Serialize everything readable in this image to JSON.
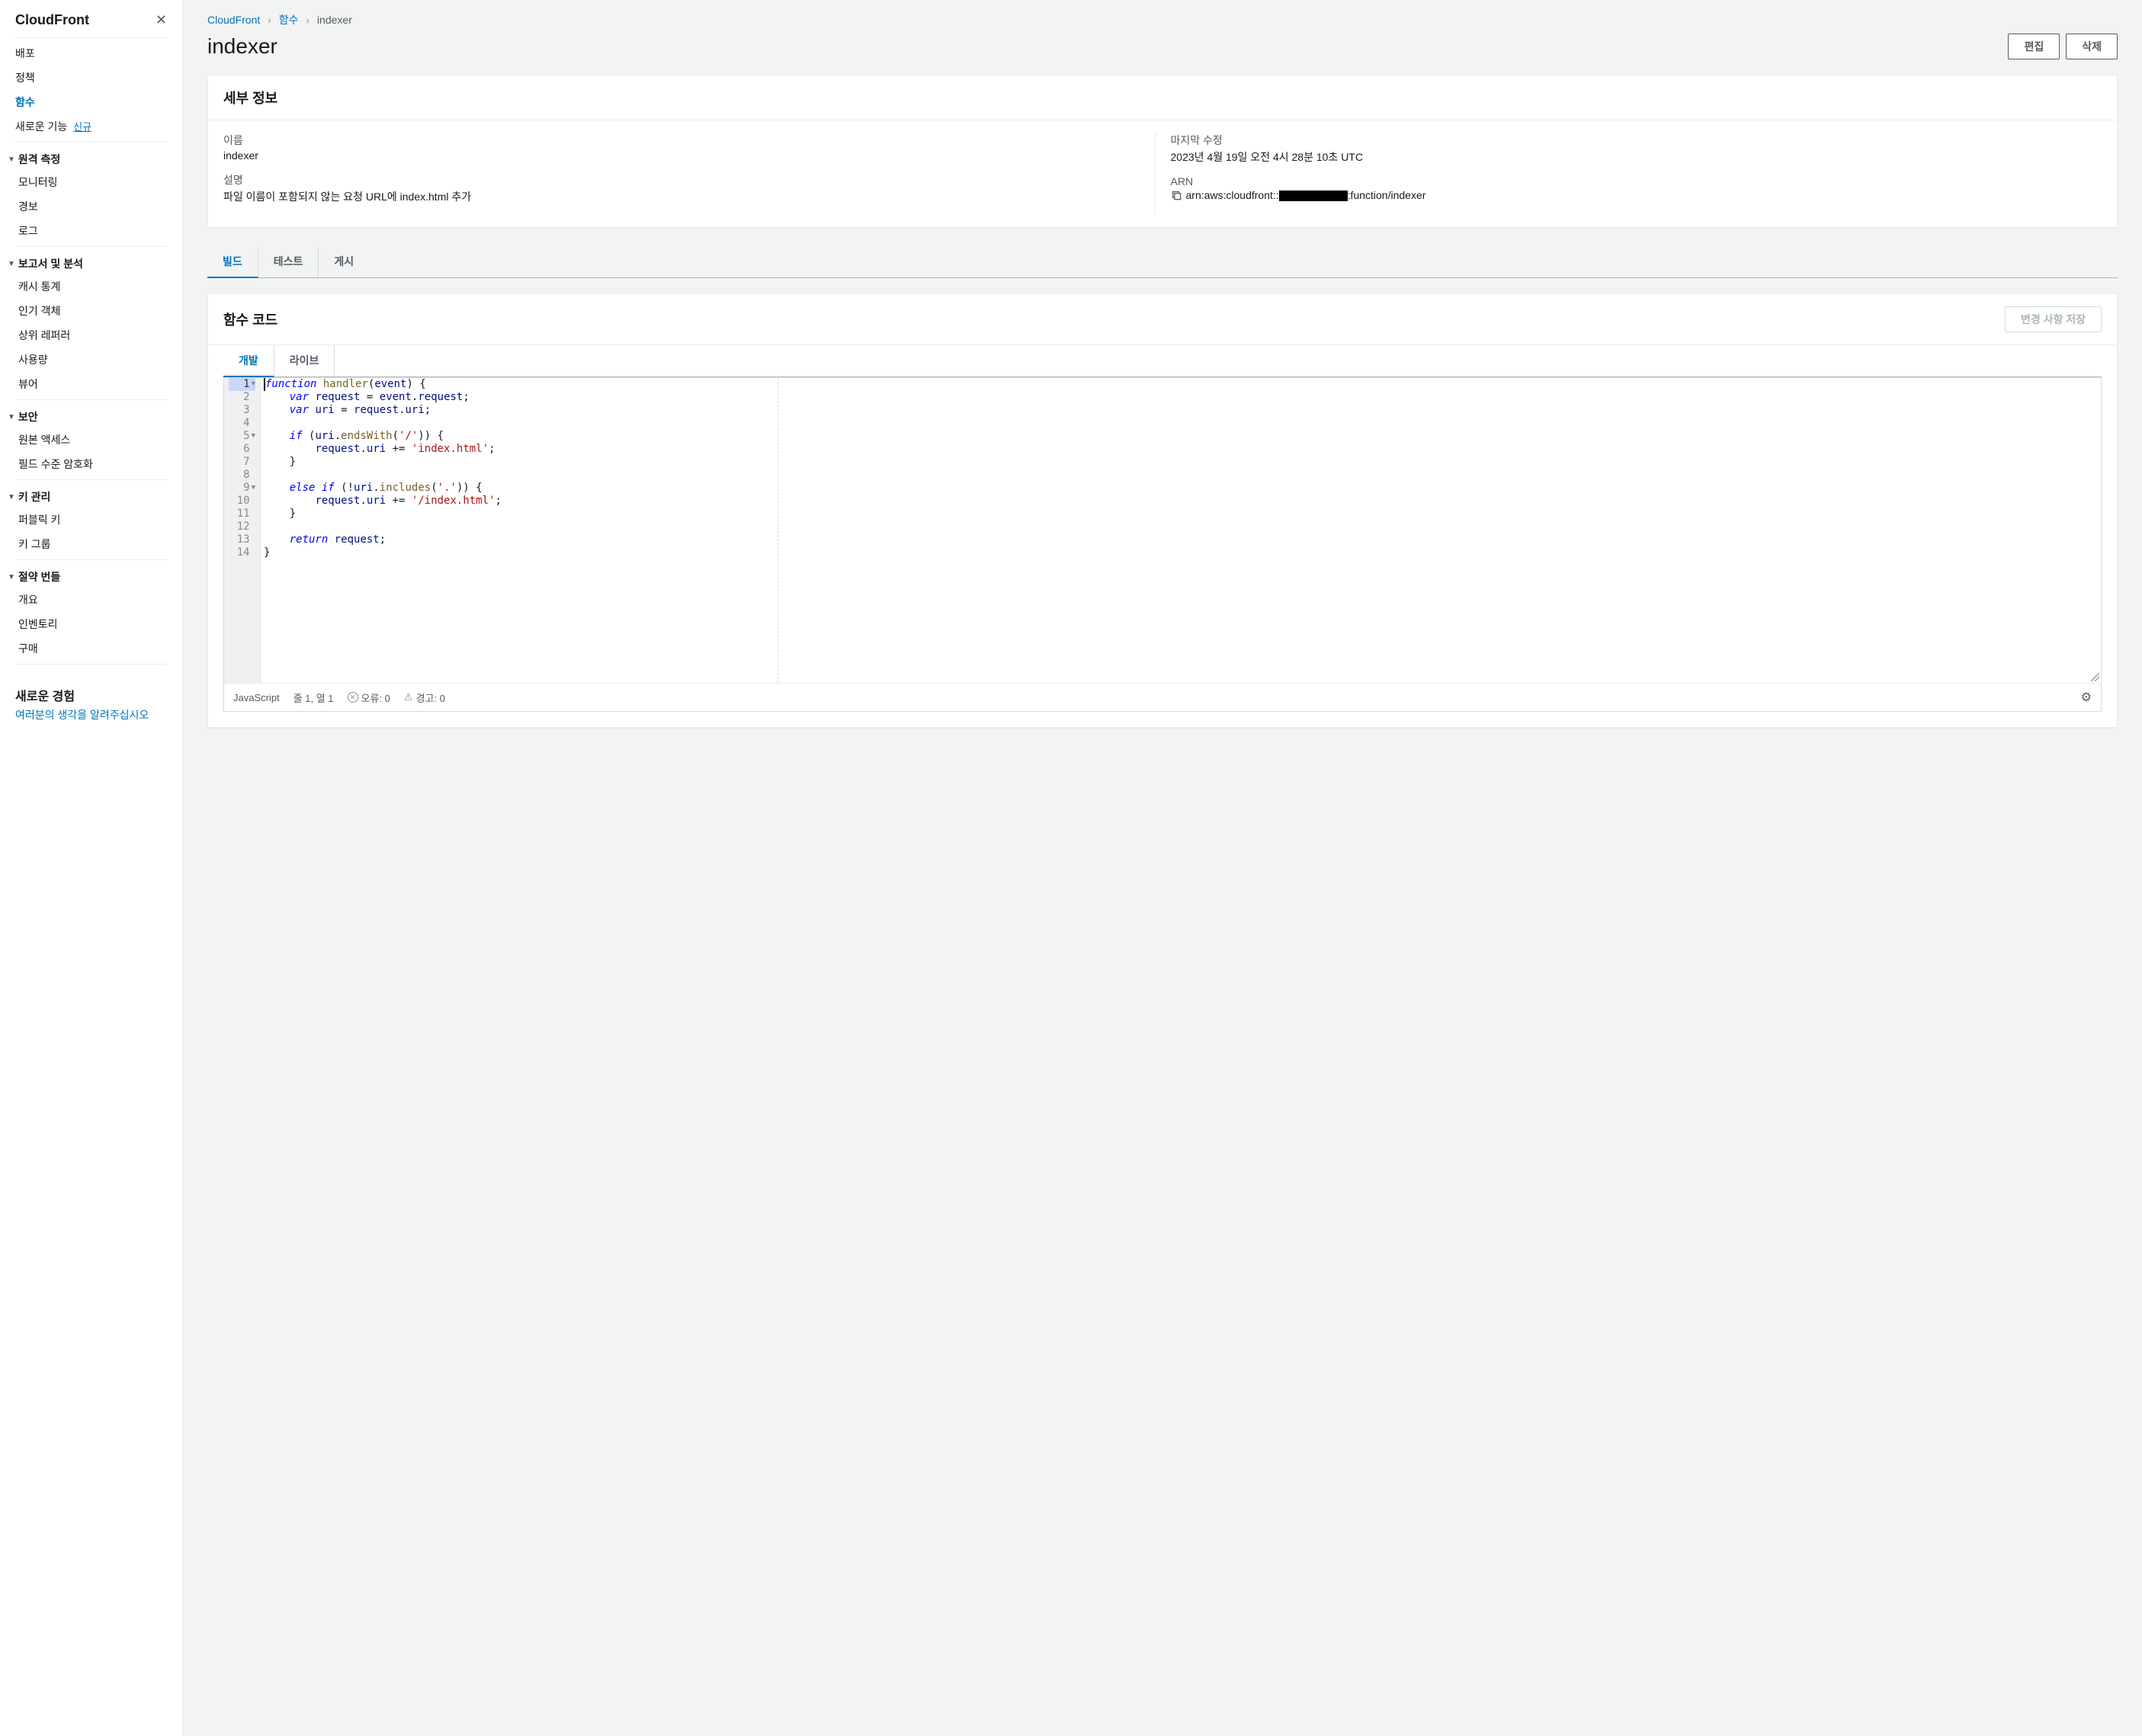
{
  "sidebar": {
    "title": "CloudFront",
    "items_top": [
      {
        "label": "배포",
        "active": false
      },
      {
        "label": "정책",
        "active": false
      },
      {
        "label": "함수",
        "active": true
      },
      {
        "label": "새로운 기능",
        "badge": "신규",
        "active": false
      }
    ],
    "groups": [
      {
        "title": "원격 측정",
        "items": [
          "모니터링",
          "경보",
          "로그"
        ]
      },
      {
        "title": "보고서 및 분석",
        "items": [
          "캐시 통계",
          "인기 객체",
          "상위 레퍼러",
          "사용량",
          "뷰어"
        ]
      },
      {
        "title": "보안",
        "items": [
          "원본 액세스",
          "필드 수준 암호화"
        ]
      },
      {
        "title": "키 관리",
        "items": [
          "퍼블릭 키",
          "키 그룹"
        ]
      },
      {
        "title": "절약 번들",
        "items": [
          "개요",
          "인벤토리",
          "구매"
        ]
      }
    ],
    "footer_title": "새로운 경험",
    "footer_link": "여러분의 생각을 알려주십시오"
  },
  "breadcrumb": {
    "root": "CloudFront",
    "mid": "함수",
    "leaf": "indexer"
  },
  "page": {
    "title": "indexer",
    "edit_btn": "편집",
    "delete_btn": "삭제"
  },
  "details": {
    "header": "세부 정보",
    "name_label": "이름",
    "name_value": "indexer",
    "desc_label": "설명",
    "desc_value": "파일 이름이 포함되지 않는 요청 URL에 index.html 추가",
    "modified_label": "마지막 수정",
    "modified_value": "2023년 4월 19일 오전 4시 28분 10초 UTC",
    "arn_label": "ARN",
    "arn_prefix": "arn:aws:cloudfront::",
    "arn_suffix": ":function/indexer"
  },
  "tabs": {
    "build": "빌드",
    "test": "테스트",
    "publish": "게시"
  },
  "code_card": {
    "header": "함수 코드",
    "save_btn": "변경 사항 저장"
  },
  "sub_tabs": {
    "dev": "개발",
    "live": "라이브"
  },
  "code": {
    "lines": [
      "function handler(event) {",
      "    var request = event.request;",
      "    var uri = request.uri;",
      "",
      "    if (uri.endsWith('/')) {",
      "        request.uri += 'index.html';",
      "    }",
      "",
      "    else if (!uri.includes('.')) {",
      "        request.uri += '/index.html';",
      "    }",
      "",
      "    return request;",
      "}"
    ]
  },
  "status": {
    "lang": "JavaScript",
    "pos": "줄 1, 열 1",
    "errors": "오류: 0",
    "warnings": "경고: 0"
  }
}
